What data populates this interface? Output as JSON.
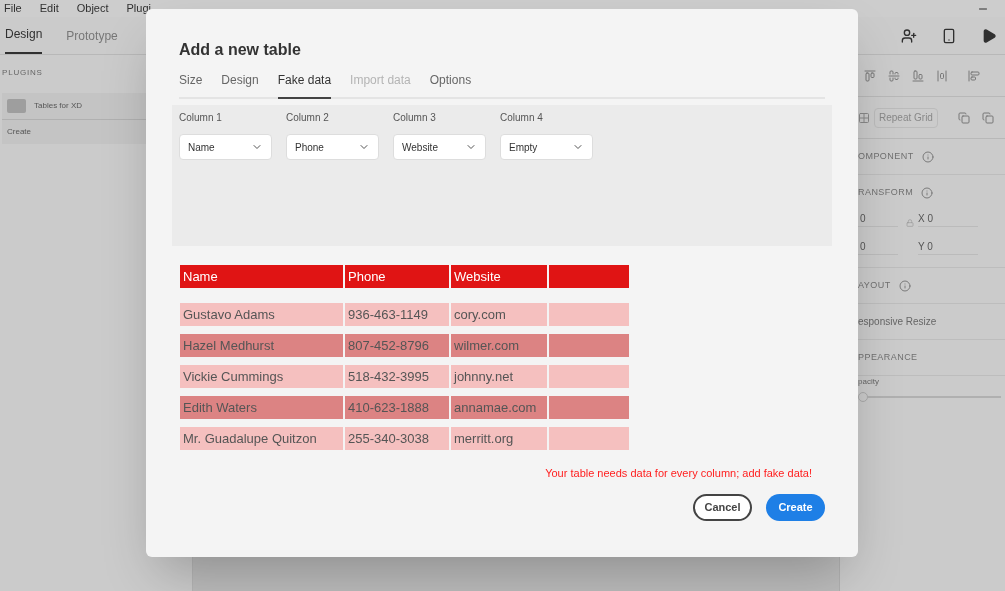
{
  "app": {
    "menu": [
      "File",
      "Edit",
      "Object",
      "Plugi"
    ],
    "mode_tabs": [
      {
        "label": "Design",
        "selected": true
      },
      {
        "label": "Prototype",
        "selected": false
      }
    ],
    "plugins_heading": "PLUGINS",
    "plugin": {
      "name": "Tables for XD",
      "action": "Create"
    },
    "right_panel": {
      "repeat_grid": "Repeat Grid",
      "component_heading": "OMPONENT",
      "transform_heading": "RANSFORM",
      "fields": [
        {
          "value": "0"
        },
        {
          "label": "X",
          "value": "0"
        },
        {
          "value": "0"
        },
        {
          "label": "Y",
          "value": "0"
        }
      ],
      "layout_heading": "AYOUT",
      "responsive": "esponsive Resize",
      "appearance_heading": "PPEARANCE",
      "opacity": {
        "label": "pacity",
        "level": 0
      }
    }
  },
  "dialog": {
    "title": "Add a new table",
    "tabs": [
      {
        "label": "Size",
        "selected": false,
        "disabled": false
      },
      {
        "label": "Design",
        "selected": false,
        "disabled": false
      },
      {
        "label": "Fake data",
        "selected": true,
        "disabled": false
      },
      {
        "label": "Import data",
        "selected": false,
        "disabled": true
      },
      {
        "label": "Options",
        "selected": false,
        "disabled": false
      }
    ],
    "columns": [
      {
        "label": "Column 1",
        "value": "Name"
      },
      {
        "label": "Column 2",
        "value": "Phone"
      },
      {
        "label": "Column 3",
        "value": "Website"
      },
      {
        "label": "Column 4",
        "value": "Empty"
      }
    ],
    "table": {
      "header": [
        "Name",
        "Phone",
        "Website"
      ],
      "rows": [
        [
          "Gustavo Adams",
          "936-463-1149",
          "cory.com"
        ],
        [
          "Hazel Medhurst",
          "807-452-8796",
          "wilmer.com"
        ],
        [
          "Vickie Cummings",
          "518-432-3995",
          "johnny.net"
        ],
        [
          "Edith Waters",
          "410-623-1888",
          "annamae.com"
        ],
        [
          "Mr. Guadalupe Quitzon",
          "255-340-3038",
          "merritt.org"
        ]
      ]
    },
    "error": "Your table needs data for every column; add fake data!",
    "buttons": [
      {
        "label": "Cancel",
        "kind": "secondary"
      },
      {
        "label": "Create",
        "kind": "primary"
      }
    ]
  }
}
